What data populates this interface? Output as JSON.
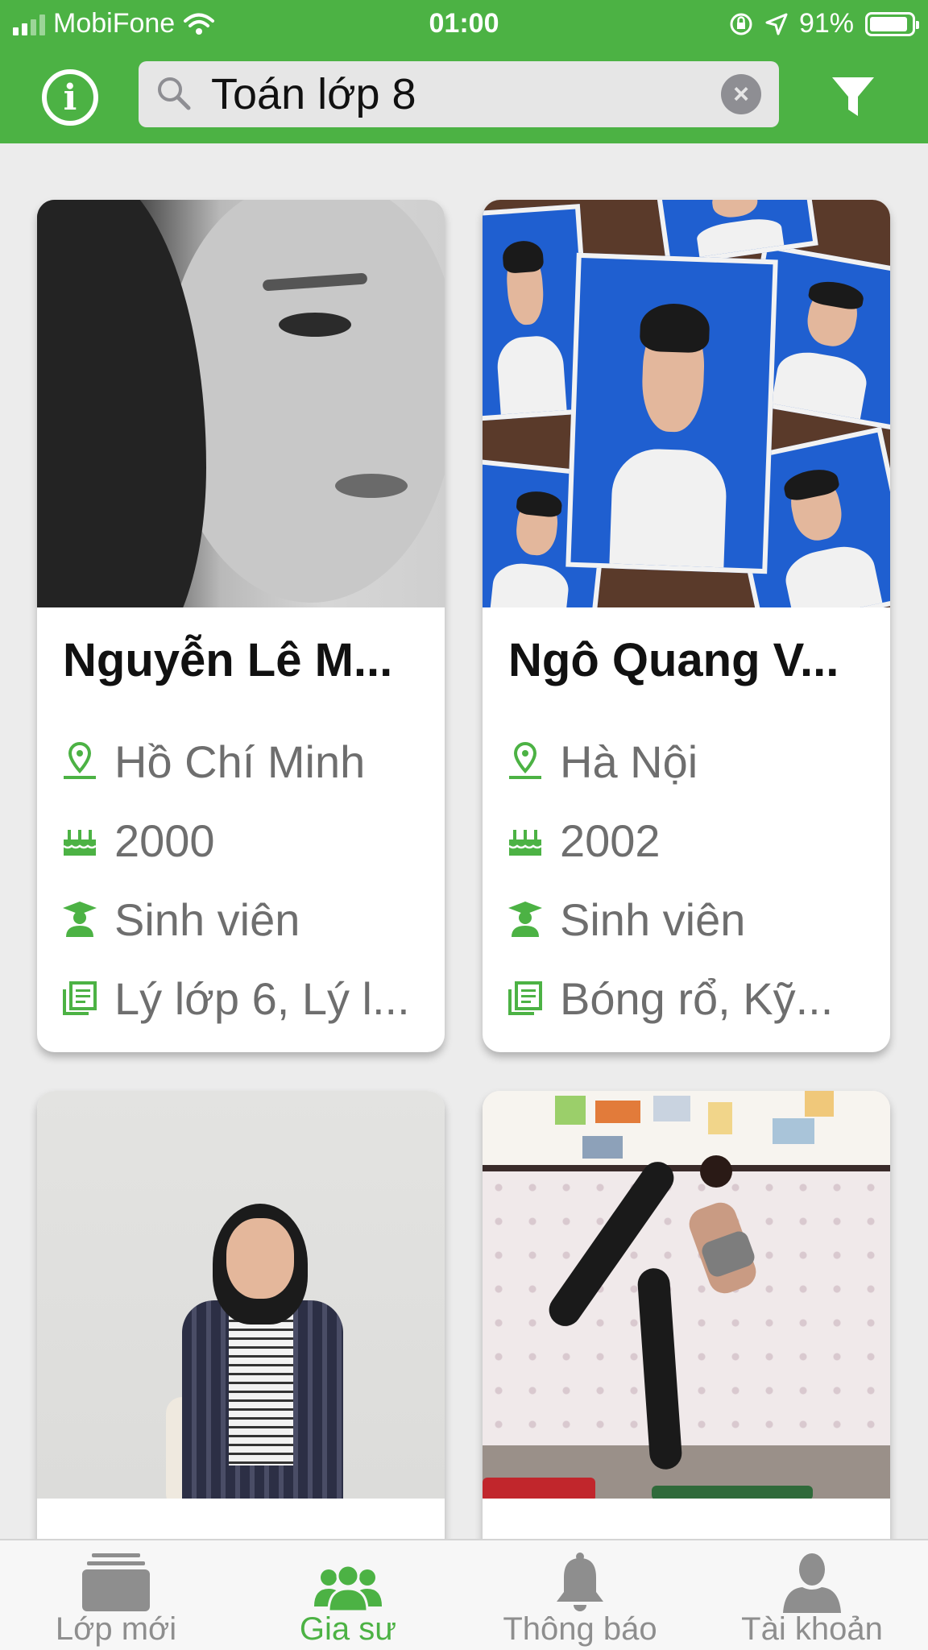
{
  "status_bar": {
    "carrier": "MobiFone",
    "time": "01:00",
    "battery_percent": "91%",
    "battery_level": 0.91
  },
  "header": {
    "search_query": "Toán lớp 8",
    "colors": {
      "brand_green": "#4cb244",
      "search_bg": "#e6e6e6"
    },
    "icons": [
      "info-icon",
      "search-icon",
      "clear-icon",
      "filter-icon"
    ]
  },
  "tutors": [
    {
      "name": "Nguyễn Lê M...",
      "location": "Hồ Chí Minh",
      "birth_year": "2000",
      "occupation": "Sinh viên",
      "subjects": "Lý lớp 6, Lý l..."
    },
    {
      "name": "Ngô Quang V...",
      "location": "Hà Nội",
      "birth_year": "2002",
      "occupation": "Sinh viên",
      "subjects": "Bóng rổ, Kỹ..."
    },
    {
      "name": "",
      "location": "",
      "birth_year": "",
      "occupation": "",
      "subjects": ""
    },
    {
      "name": "",
      "location": "",
      "birth_year": "",
      "occupation": "",
      "subjects": ""
    }
  ],
  "tab_bar": {
    "active": "Gia sư",
    "tabs": [
      {
        "label": "Lớp mới",
        "icon": "classes-icon"
      },
      {
        "label": "Gia sư",
        "icon": "tutors-icon"
      },
      {
        "label": "Thông báo",
        "icon": "bell-icon"
      },
      {
        "label": "Tài khoản",
        "icon": "account-icon"
      }
    ]
  }
}
